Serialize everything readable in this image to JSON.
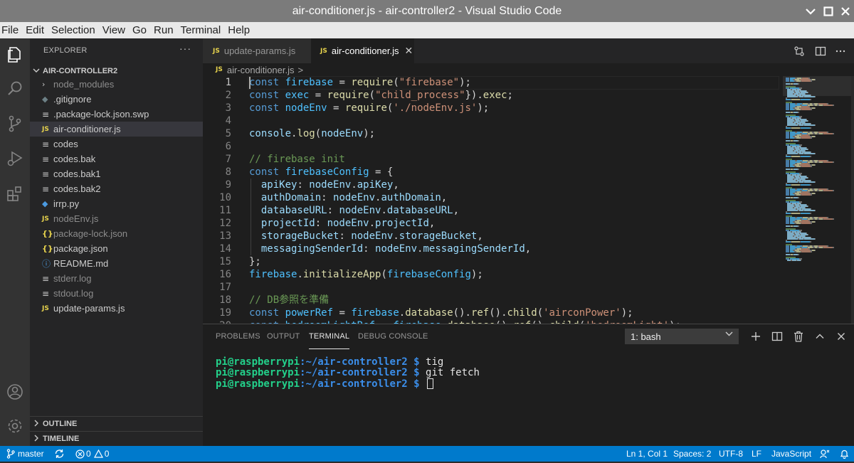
{
  "window": {
    "title": "air-conditioner.js - air-controller2 - Visual Studio Code"
  },
  "menubar": [
    "File",
    "Edit",
    "Selection",
    "View",
    "Go",
    "Run",
    "Terminal",
    "Help"
  ],
  "sidebar": {
    "header": "EXPLORER",
    "more": "···",
    "folder": "AIR-CONTROLLER2",
    "items": [
      {
        "name": "node_modules",
        "icon": "folder-chevron-icon",
        "glyph": "›",
        "cls": "folder",
        "dim": true
      },
      {
        "name": ".gitignore",
        "icon": "git-icon",
        "glyph": "◆",
        "cls": "git",
        "dim": false
      },
      {
        "name": ".package-lock.json.swp",
        "icon": "text-file-icon",
        "glyph": "≡",
        "cls": "txt",
        "dim": false
      },
      {
        "name": "air-conditioner.js",
        "icon": "js-file-icon",
        "glyph": "JS",
        "cls": "js",
        "dim": false,
        "active": true
      },
      {
        "name": "codes",
        "icon": "text-file-icon",
        "glyph": "≡",
        "cls": "txt",
        "dim": false
      },
      {
        "name": "codes.bak",
        "icon": "text-file-icon",
        "glyph": "≡",
        "cls": "txt",
        "dim": false
      },
      {
        "name": "codes.bak1",
        "icon": "text-file-icon",
        "glyph": "≡",
        "cls": "txt",
        "dim": false
      },
      {
        "name": "codes.bak2",
        "icon": "text-file-icon",
        "glyph": "≡",
        "cls": "txt",
        "dim": false
      },
      {
        "name": "irrp.py",
        "icon": "python-file-icon",
        "glyph": "◆",
        "cls": "py",
        "dim": false
      },
      {
        "name": "nodeEnv.js",
        "icon": "js-file-icon",
        "glyph": "JS",
        "cls": "js",
        "dim": true
      },
      {
        "name": "package-lock.json",
        "icon": "json-file-icon",
        "glyph": "{}",
        "cls": "json",
        "dim": true
      },
      {
        "name": "package.json",
        "icon": "json-file-icon",
        "glyph": "{}",
        "cls": "json",
        "dim": false
      },
      {
        "name": "README.md",
        "icon": "info-icon",
        "glyph": "ⓘ",
        "cls": "info",
        "dim": false
      },
      {
        "name": "stderr.log",
        "icon": "text-file-icon",
        "glyph": "≡",
        "cls": "txt",
        "dim": true
      },
      {
        "name": "stdout.log",
        "icon": "text-file-icon",
        "glyph": "≡",
        "cls": "txt",
        "dim": true
      },
      {
        "name": "update-params.js",
        "icon": "js-file-icon",
        "glyph": "JS",
        "cls": "js",
        "dim": false
      }
    ],
    "outline": "OUTLINE",
    "timeline": "TIMELINE"
  },
  "tabs": [
    {
      "label": "update-params.js",
      "icon": "JS",
      "active": false
    },
    {
      "label": "air-conditioner.js",
      "icon": "JS",
      "active": true,
      "close": "✕"
    }
  ],
  "breadcrumb": {
    "icon": "JS",
    "file": "air-conditioner.js",
    "sep": ">"
  },
  "editor": {
    "lines": [
      [
        [
          "kw",
          "const"
        ],
        [
          "pl",
          " "
        ],
        [
          "var",
          "firebase"
        ],
        [
          "pl",
          " = "
        ],
        [
          "fn",
          "require"
        ],
        [
          "pl",
          "("
        ],
        [
          "str",
          "\"firebase\""
        ],
        [
          "pl",
          ");"
        ]
      ],
      [
        [
          "kw",
          "const"
        ],
        [
          "pl",
          " "
        ],
        [
          "var",
          "exec"
        ],
        [
          "pl",
          " = "
        ],
        [
          "fn",
          "require"
        ],
        [
          "pl",
          "("
        ],
        [
          "str",
          "\"child_process\""
        ],
        [
          "pl",
          "})."
        ],
        [
          "fn",
          "exec"
        ],
        [
          "pl",
          ";"
        ]
      ],
      [
        [
          "kw",
          "const"
        ],
        [
          "pl",
          " "
        ],
        [
          "var",
          "nodeEnv"
        ],
        [
          "pl",
          " = "
        ],
        [
          "fn",
          "require"
        ],
        [
          "pl",
          "("
        ],
        [
          "str",
          "'./nodeEnv.js'"
        ],
        [
          "pl",
          ");"
        ]
      ],
      [],
      [
        [
          "prop",
          "console"
        ],
        [
          "pl",
          "."
        ],
        [
          "fn",
          "log"
        ],
        [
          "pl",
          "("
        ],
        [
          "prop",
          "nodeEnv"
        ],
        [
          "pl",
          ");"
        ]
      ],
      [],
      [
        [
          "com",
          "// firebase init"
        ]
      ],
      [
        [
          "kw",
          "const"
        ],
        [
          "pl",
          " "
        ],
        [
          "var",
          "firebaseConfig"
        ],
        [
          "pl",
          " = {"
        ]
      ],
      [
        [
          "pl",
          "  "
        ],
        [
          "prop",
          "apiKey"
        ],
        [
          "pl",
          ": "
        ],
        [
          "prop",
          "nodeEnv"
        ],
        [
          "pl",
          "."
        ],
        [
          "prop",
          "apiKey"
        ],
        [
          "pl",
          ","
        ]
      ],
      [
        [
          "pl",
          "  "
        ],
        [
          "prop",
          "authDomain"
        ],
        [
          "pl",
          ": "
        ],
        [
          "prop",
          "nodeEnv"
        ],
        [
          "pl",
          "."
        ],
        [
          "prop",
          "authDomain"
        ],
        [
          "pl",
          ","
        ]
      ],
      [
        [
          "pl",
          "  "
        ],
        [
          "prop",
          "databaseURL"
        ],
        [
          "pl",
          ": "
        ],
        [
          "prop",
          "nodeEnv"
        ],
        [
          "pl",
          "."
        ],
        [
          "prop",
          "databaseURL"
        ],
        [
          "pl",
          ","
        ]
      ],
      [
        [
          "pl",
          "  "
        ],
        [
          "prop",
          "projectId"
        ],
        [
          "pl",
          ": "
        ],
        [
          "prop",
          "nodeEnv"
        ],
        [
          "pl",
          "."
        ],
        [
          "prop",
          "projectId"
        ],
        [
          "pl",
          ","
        ]
      ],
      [
        [
          "pl",
          "  "
        ],
        [
          "prop",
          "storageBucket"
        ],
        [
          "pl",
          ": "
        ],
        [
          "prop",
          "nodeEnv"
        ],
        [
          "pl",
          "."
        ],
        [
          "prop",
          "storageBucket"
        ],
        [
          "pl",
          ","
        ]
      ],
      [
        [
          "pl",
          "  "
        ],
        [
          "prop",
          "messagingSenderId"
        ],
        [
          "pl",
          ": "
        ],
        [
          "prop",
          "nodeEnv"
        ],
        [
          "pl",
          "."
        ],
        [
          "prop",
          "messagingSenderId"
        ],
        [
          "pl",
          ","
        ]
      ],
      [
        [
          "pl",
          "};"
        ]
      ],
      [
        [
          "var",
          "firebase"
        ],
        [
          "pl",
          "."
        ],
        [
          "fn",
          "initializeApp"
        ],
        [
          "pl",
          "("
        ],
        [
          "var",
          "firebaseConfig"
        ],
        [
          "pl",
          ");"
        ]
      ],
      [],
      [
        [
          "com",
          "// DB参照を準備"
        ]
      ],
      [
        [
          "kw",
          "const"
        ],
        [
          "pl",
          " "
        ],
        [
          "var",
          "powerRef"
        ],
        [
          "pl",
          " = "
        ],
        [
          "var",
          "firebase"
        ],
        [
          "pl",
          "."
        ],
        [
          "fn",
          "database"
        ],
        [
          "pl",
          "()."
        ],
        [
          "fn",
          "ref"
        ],
        [
          "pl",
          "()."
        ],
        [
          "fn",
          "child"
        ],
        [
          "pl",
          "("
        ],
        [
          "str",
          "'airconPower'"
        ],
        [
          "pl",
          ");"
        ]
      ],
      [
        [
          "kw",
          "const"
        ],
        [
          "pl",
          " "
        ],
        [
          "var",
          "bedroomLightRef"
        ],
        [
          "pl",
          " = "
        ],
        [
          "var",
          "firebase"
        ],
        [
          "pl",
          "."
        ],
        [
          "fn",
          "database"
        ],
        [
          "pl",
          "()."
        ],
        [
          "fn",
          "ref"
        ],
        [
          "pl",
          "()."
        ],
        [
          "fn",
          "child"
        ],
        [
          "pl",
          "("
        ],
        [
          "str",
          "'bedroomLight'"
        ],
        [
          "pl",
          ");"
        ]
      ]
    ]
  },
  "panel": {
    "tabs": [
      "PROBLEMS",
      "OUTPUT",
      "TERMINAL",
      "DEBUG CONSOLE"
    ],
    "active_tab": "TERMINAL",
    "terminal_select": "1: bash",
    "terminal": [
      {
        "user": "pi@raspberrypi",
        "path": ":~/air-controller2 $",
        "cmd": " tig",
        "cursor": false
      },
      {
        "user": "pi@raspberrypi",
        "path": ":~/air-controller2 $",
        "cmd": " git fetch",
        "cursor": false
      },
      {
        "user": "pi@raspberrypi",
        "path": ":~/air-controller2 $",
        "cmd": " ",
        "cursor": true
      }
    ]
  },
  "statusbar": {
    "branch": "master",
    "errors": "0",
    "warnings": "0",
    "position": "Ln 1, Col 1",
    "spaces": "Spaces: 2",
    "encoding": "UTF-8",
    "eol": "LF",
    "language": "JavaScript"
  },
  "colors": {
    "statusbar": "#007acc",
    "titlebar": "#7b7b7b",
    "activitybar": "#333333",
    "sidebar": "#252526",
    "editor": "#1e1e1e"
  }
}
